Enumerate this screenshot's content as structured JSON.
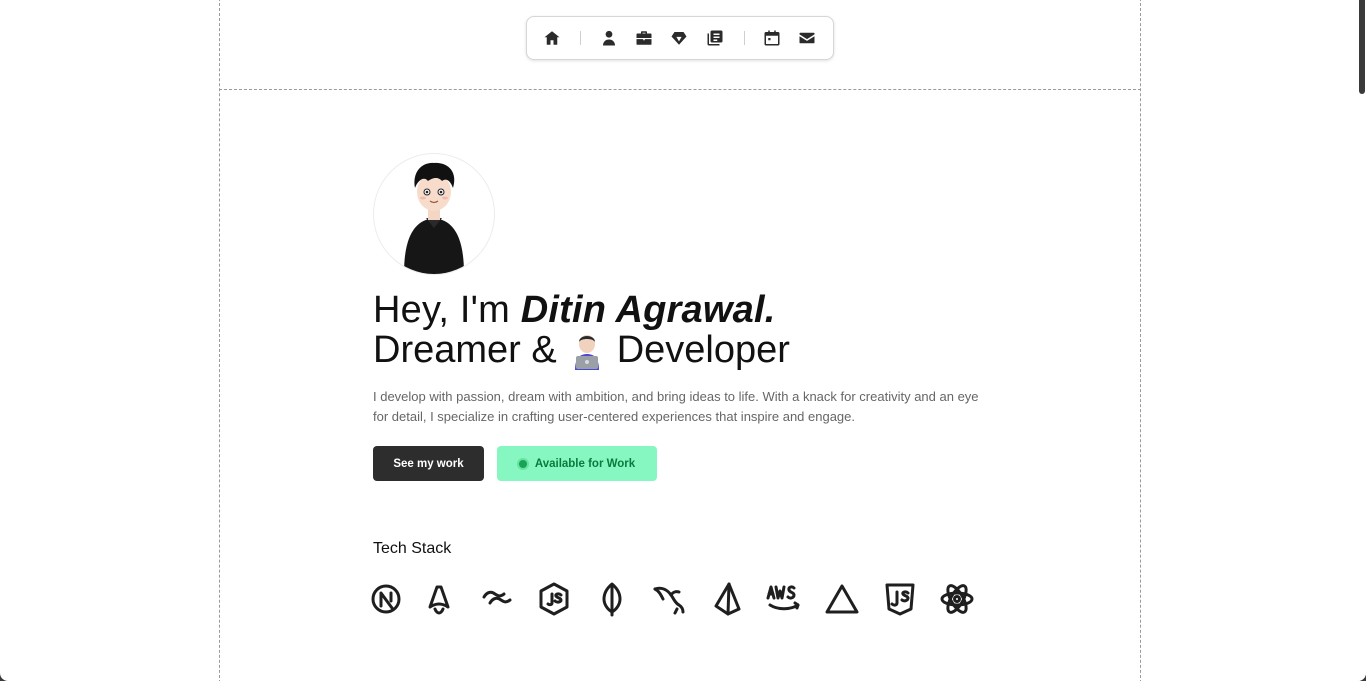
{
  "nav": {
    "items": [
      {
        "icon": "home-icon"
      },
      {
        "icon": "user-icon"
      },
      {
        "icon": "briefcase-icon"
      },
      {
        "icon": "gem-icon"
      },
      {
        "icon": "notes-icon"
      },
      {
        "icon": "calendar-icon"
      },
      {
        "icon": "mail-icon"
      }
    ]
  },
  "hero": {
    "greeting": "Hey, I'm ",
    "name": "Ditin Agrawal.",
    "tagline_pre": "Dreamer &",
    "tagline_post": "Developer",
    "description": "I develop with passion, dream with ambition, and bring ideas to life. With a knack for creativity and an eye for detail, I specialize in crafting user-centered experiences that inspire and engage.",
    "primary_button": "See my work",
    "status_button": "Available for Work"
  },
  "tech_stack": {
    "title": "Tech Stack",
    "icons": [
      "nextjs-icon",
      "astro-icon",
      "tailwind-icon",
      "nodejs-icon",
      "mongodb-icon",
      "mysql-icon",
      "prisma-icon",
      "aws-icon",
      "vercel-icon",
      "javascript-icon",
      "react-icon"
    ]
  },
  "colors": {
    "primary_button": "#2d2d2d",
    "status_bg": "#86f7c0",
    "status_text": "#0b7a3e",
    "status_dot": "#15a553"
  }
}
